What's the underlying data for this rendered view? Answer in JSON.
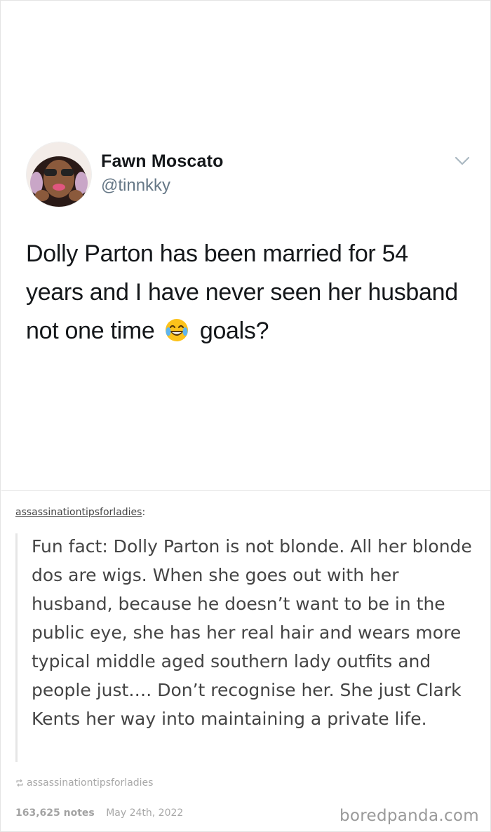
{
  "tweet": {
    "display_name": "Fawn Moscato",
    "handle": "@tinnkky",
    "text_before_emoji": "Dolly Parton has been married for 54 years and I have never seen her husband not one time",
    "emoji": "face-with-tears-of-joy",
    "text_after_emoji": "goals?"
  },
  "reblog": {
    "username": "assassinationtipsforladies",
    "separator": ":",
    "quote": "Fun fact: Dolly Parton is not blonde. All her blonde dos are wigs. When she goes out with her husband, because he doesn’t want to be in the public eye, she has her real hair and wears more typical middle aged southern lady outfits and people just…. Don’t recognise her. She just Clark Kents her way into maintaining a private life."
  },
  "source": {
    "username": "assassinationtipsforladies",
    "icon": "reblog-icon"
  },
  "footer": {
    "notes": "163,625 notes",
    "date": "May 24th, 2022"
  },
  "watermark": "boredpanda.com",
  "colors": {
    "text_primary": "#14171a",
    "text_secondary": "#657786",
    "muted": "#a8a8a8"
  }
}
